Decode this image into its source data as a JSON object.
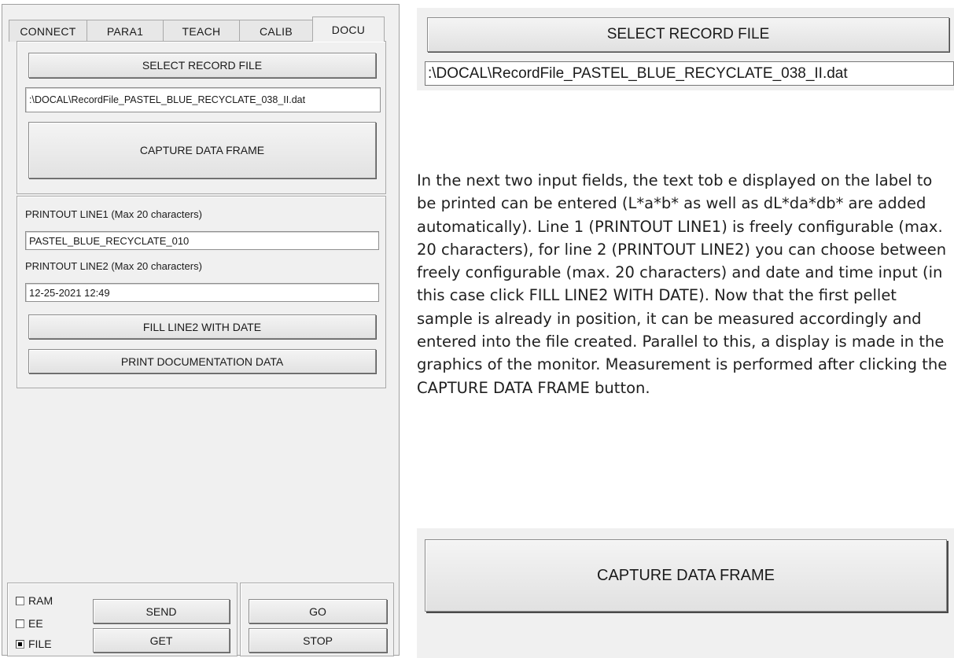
{
  "app": {
    "tabs": [
      {
        "label": "CONNECT"
      },
      {
        "label": "PARA1"
      },
      {
        "label": "TEACH"
      },
      {
        "label": "CALIB"
      },
      {
        "label": "DOCU"
      }
    ],
    "active_tab": "DOCU",
    "record": {
      "select_label": "SELECT RECORD FILE",
      "file_path": ":\\DOCAL\\RecordFile_PASTEL_BLUE_RECYCLATE_038_II.dat",
      "capture_label": "CAPTURE DATA FRAME"
    },
    "printout": {
      "line1_label": "PRINTOUT LINE1 (Max 20 characters)",
      "line1_value": "PASTEL_BLUE_RECYCLATE_010",
      "line2_label": "PRINTOUT LINE2 (Max 20 characters)",
      "line2_value": "12-25-2021  12:49",
      "fill_date_label": "FILL LINE2 WITH DATE",
      "print_label": "PRINT DOCUMENTATION DATA"
    },
    "footer": {
      "ram_label": "RAM",
      "ee_label": "EE",
      "file_label": "FILE",
      "ram_checked": false,
      "ee_checked": false,
      "file_checked": true,
      "send_label": "SEND",
      "get_label": "GET",
      "go_label": "GO",
      "stop_label": "STOP"
    }
  },
  "zoom_top": {
    "select_label": "SELECT RECORD FILE",
    "file_path": ":\\DOCAL\\RecordFile_PASTEL_BLUE_RECYCLATE_038_II.dat"
  },
  "description": "In the next two input fields, the text tob e displayed on the label to be printed can be entered (L*a*b* as well as dL*da*db* are added automatically). Line 1 (PRINTOUT LINE1) is freely configurable (max. 20 characters), for line 2 (PRINTOUT LINE2) you can choose between freely configurable (max. 20 characters) and date and time input (in this case click FILL LINE2 WITH DATE). Now that the first pellet sample is already in position, it can be measured accordingly and entered into the file created. Parallel to this, a display is made in the graphics of the monitor. Measurement is performed after clicking the CAPTURE DATA FRAME button.",
  "zoom_bottom": {
    "capture_label": "CAPTURE DATA FRAME"
  }
}
